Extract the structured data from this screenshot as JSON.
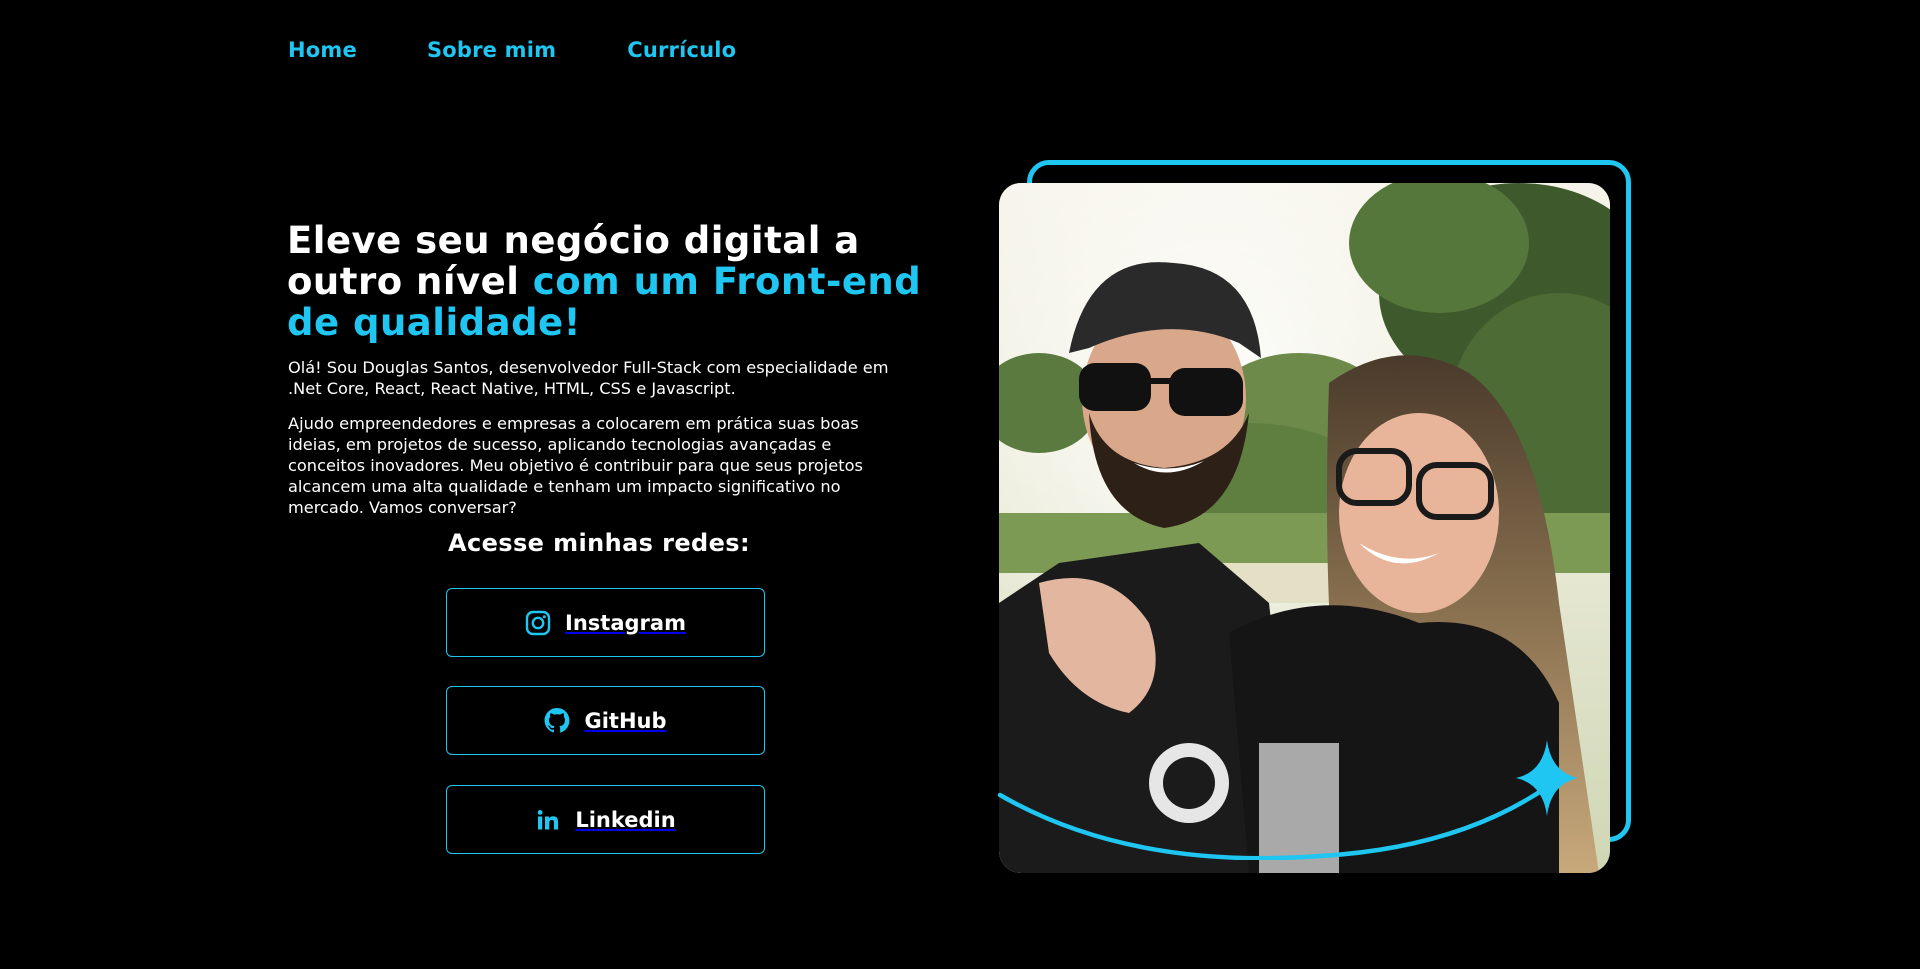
{
  "nav": {
    "items": [
      {
        "label": "Home"
      },
      {
        "label": "Sobre mim"
      },
      {
        "label": "Currículo"
      }
    ]
  },
  "hero": {
    "headline_white": "Eleve seu negócio digital a outro nível ",
    "headline_accent": "com um Front-end de qualidade!",
    "paragraph_1": "Olá! Sou Douglas Santos, desenvolvedor Full-Stack com especialidade em .Net Core, React, React Native, HTML, CSS e Javascript.",
    "paragraph_2": "Ajudo empreendedores e empresas a colocarem em prática suas boas ideias, em projetos de sucesso, aplicando tecnologias avançadas e conceitos inovadores. Meu objetivo é contribuir para que seus projetos alcancem uma alta qualidade e tenham um impacto significativo no mercado. Vamos conversar?"
  },
  "social": {
    "title": "Acesse minhas redes:",
    "buttons": [
      {
        "label": "Instagram",
        "icon": "instagram-icon"
      },
      {
        "label": "GitHub",
        "icon": "github-icon"
      },
      {
        "label": "Linkedin",
        "icon": "linkedin-icon"
      }
    ]
  },
  "colors": {
    "background": "#000000",
    "accent": "#1fc6f2",
    "text": "#ffffff"
  }
}
